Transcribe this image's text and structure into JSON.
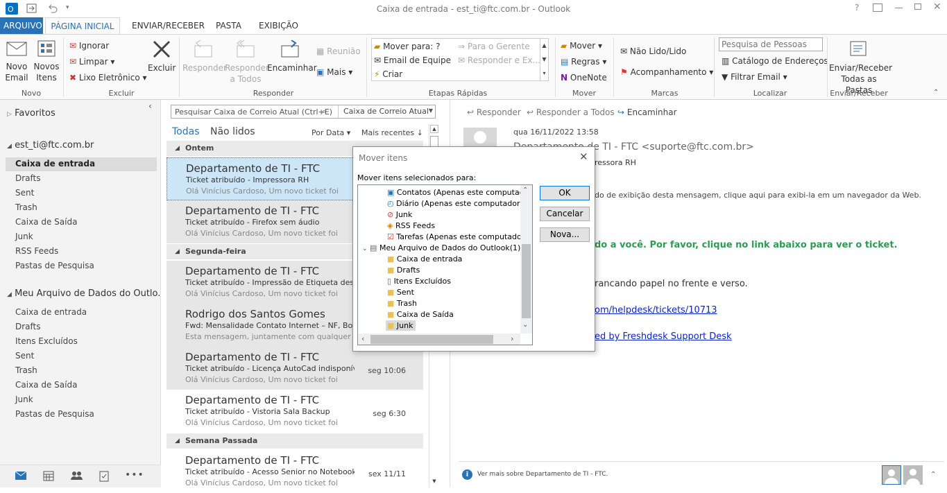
{
  "window": {
    "title": "Caixa de entrada - est_ti@ftc.com.br - Outlook"
  },
  "tabs": {
    "file": "ARQUIVO",
    "home": "PÁGINA INICIAL",
    "send": "ENVIAR/RECEBER",
    "folder": "PASTA",
    "view": "EXIBIÇÃO"
  },
  "ribbon": {
    "novo": {
      "email": "Novo\nEmail",
      "email1": "Novo",
      "email2": "Email",
      "itens1": "Novos",
      "itens2": "Itens",
      "label": "Novo"
    },
    "excluir": {
      "ignorar": "Ignorar",
      "limpar": "Limpar",
      "lixo": "Lixo Eletrônico",
      "excluir": "Excluir",
      "label": "Excluir"
    },
    "responder": {
      "responder": "Responder",
      "todos1": "Responder",
      "todos2": "a Todos",
      "encaminhar": "Encaminhar",
      "reuniao": "Reunião",
      "mais": "Mais",
      "label": "Responder"
    },
    "etapas": {
      "mover_para": "Mover para: ?",
      "email_equipe": "Email de Equipe",
      "criar": "Criar",
      "para_gerente": "Para o Gerente",
      "responder_ex": "Responder e Ex...",
      "label": "Etapas Rápidas"
    },
    "mover": {
      "mover": "Mover",
      "regras": "Regras",
      "onenote": "OneNote",
      "label": "Mover"
    },
    "marcas": {
      "nao_lido": "Não Lido/Lido",
      "acompanhamento": "Acompanhamento",
      "label": "Marcas"
    },
    "localizar": {
      "pesquisa_placeholder": "Pesquisa de Pessoas",
      "catalogo": "Catálogo de Endereços",
      "filtrar": "Filtrar Email",
      "label": "Localizar"
    },
    "enviar": {
      "l1": "Enviar/Receber",
      "l2": "Todas as Pastas",
      "label": "Enviar/Receber"
    }
  },
  "sidebar": {
    "favoritos": "Favoritos",
    "account": "est_ti@ftc.com.br",
    "account_items": [
      "Caixa de entrada",
      "Drafts",
      "Sent",
      "Trash",
      "Caixa de Saída",
      "Junk",
      "RSS Feeds",
      "Pastas de Pesquisa"
    ],
    "datafile": "Meu Arquivo de Dados do Outlo...",
    "datafile_items": [
      "Caixa de entrada",
      "Drafts",
      "Itens Excluídos",
      "Sent",
      "Trash",
      "Caixa de Saída",
      "Junk",
      "Pastas de Pesquisa"
    ]
  },
  "list": {
    "search_placeholder": "Pesquisar Caixa de Correio Atual (Ctrl+E)",
    "scope": "Caixa de Correio Atual",
    "filter_all": "Todas",
    "filter_unread": "Não lidos",
    "sort_by": "Por Data",
    "sort_order": "Mais recentes",
    "groups": [
      "Ontem",
      "Segunda-feira",
      "Semana Passada"
    ],
    "messages": [
      {
        "from": "Departamento de TI - FTC",
        "subject": "Ticket atribuído - Impressora RH",
        "preview": "Olá Vinícius Cardoso,  Um novo ticket foi",
        "time": ""
      },
      {
        "from": "Departamento de TI - FTC",
        "subject": "Ticket atribuído - Firefox sem áudio",
        "preview": "Olá Vinícius Cardoso,  Um novo ticket foi",
        "time": ""
      },
      {
        "from": "Departamento de TI - FTC",
        "subject": "Ticket atribuído - Impressão de Etiqueta desc...",
        "preview": "Olá Vinícius Cardoso,  Um novo ticket foi",
        "time": ""
      },
      {
        "from": "Rodrigo dos Santos Gomes",
        "subject": "Fwd: Mensalidade Contato Internet – NF, Bol...",
        "preview": "Esta mensagem, juntamente com qualquer",
        "time": ""
      },
      {
        "from": "Departamento de TI - FTC",
        "subject": "Ticket atribuído - Licença AutoCad indisponível",
        "preview": "Olá Vinícius Cardoso,  Um novo ticket foi",
        "time": "seg 10:06"
      },
      {
        "from": "Departamento de TI - FTC",
        "subject": "Ticket atribuído - Vistoria Sala Backup",
        "preview": "Olá Vinícius Cardoso,  Um novo ticket foi",
        "time": "seg 6:30"
      },
      {
        "from": "Departamento de TI - FTC",
        "subject": "Ticket atribuído - Acesso Senior no Notebook...",
        "preview": "Olá Vinícius Cardoso,  Um novo ticket foi",
        "time": "sex 11/11"
      }
    ]
  },
  "reading": {
    "responder": "Responder",
    "responder_todos": "Responder a Todos",
    "encaminhar": "Encaminhar",
    "date": "qua 16/11/2022 13:58",
    "sender": "Departamento de TI - FTC <suporte@ftc.com.br>",
    "subject_frag": "ressora RH",
    "info_frag": "do de exibição desta mensagem, clique aqui para exibi-la em um navegador da Web.",
    "green_frag": "do a você. Por favor, clique no link abaixo para ver o ticket.",
    "body_frag": "rancando papel no frente e verso.",
    "link_frag": "om/helpdesk/tickets/10713",
    "powered_frag": "ed by Freshdesk Support Desk",
    "people_pane": "Ver mais sobre Departamento de TI - FTC."
  },
  "dialog": {
    "title": "Mover itens",
    "prompt": "Mover itens selecionados para:",
    "ok": "OK",
    "cancel": "Cancelar",
    "new": "Nova...",
    "tree": [
      "Contatos (Apenas este computador)",
      "Diário (Apenas este computador)",
      "Junk",
      "RSS Feeds",
      "Tarefas (Apenas este computador)",
      "Meu Arquivo de Dados do Outlook(1)",
      "Caixa de entrada",
      "Drafts",
      "Itens Excluídos",
      "Sent",
      "Trash",
      "Caixa de Saída",
      "Junk"
    ]
  }
}
